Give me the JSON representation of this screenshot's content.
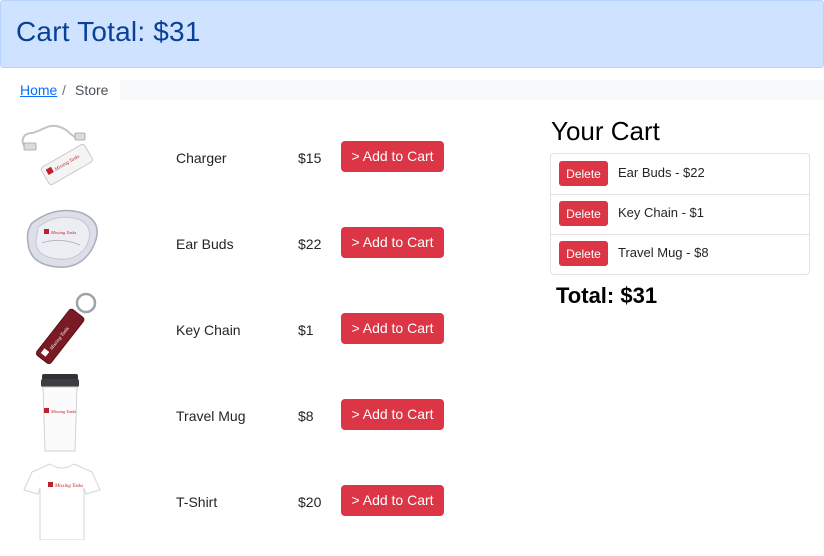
{
  "header": {
    "title": "Cart Total: $31"
  },
  "breadcrumb": {
    "home": "Home",
    "separator": "/",
    "current": "Store"
  },
  "products": [
    {
      "name": "Charger",
      "price": "$15",
      "button": "> Add to Cart",
      "icon": "charger-image"
    },
    {
      "name": "Ear Buds",
      "price": "$22",
      "button": "> Add to Cart",
      "icon": "earbuds-image"
    },
    {
      "name": "Key Chain",
      "price": "$1",
      "button": "> Add to Cart",
      "icon": "keychain-image"
    },
    {
      "name": "Travel Mug",
      "price": "$8",
      "button": "> Add to Cart",
      "icon": "travel-mug-image"
    },
    {
      "name": "T-Shirt",
      "price": "$20",
      "button": "> Add to Cart",
      "icon": "tshirt-image"
    }
  ],
  "cart": {
    "title": "Your Cart",
    "items": [
      {
        "label": "Ear Buds - $22",
        "delete": "Delete"
      },
      {
        "label": "Key Chain - $1",
        "delete": "Delete"
      },
      {
        "label": "Travel Mug - $8",
        "delete": "Delete"
      }
    ],
    "total": "Total: $31"
  },
  "brand_text": "Missing Tasks",
  "colors": {
    "header_bg": "#cfe2ff",
    "header_text": "#084298",
    "danger": "#dc3545",
    "link": "#0d6efd"
  }
}
